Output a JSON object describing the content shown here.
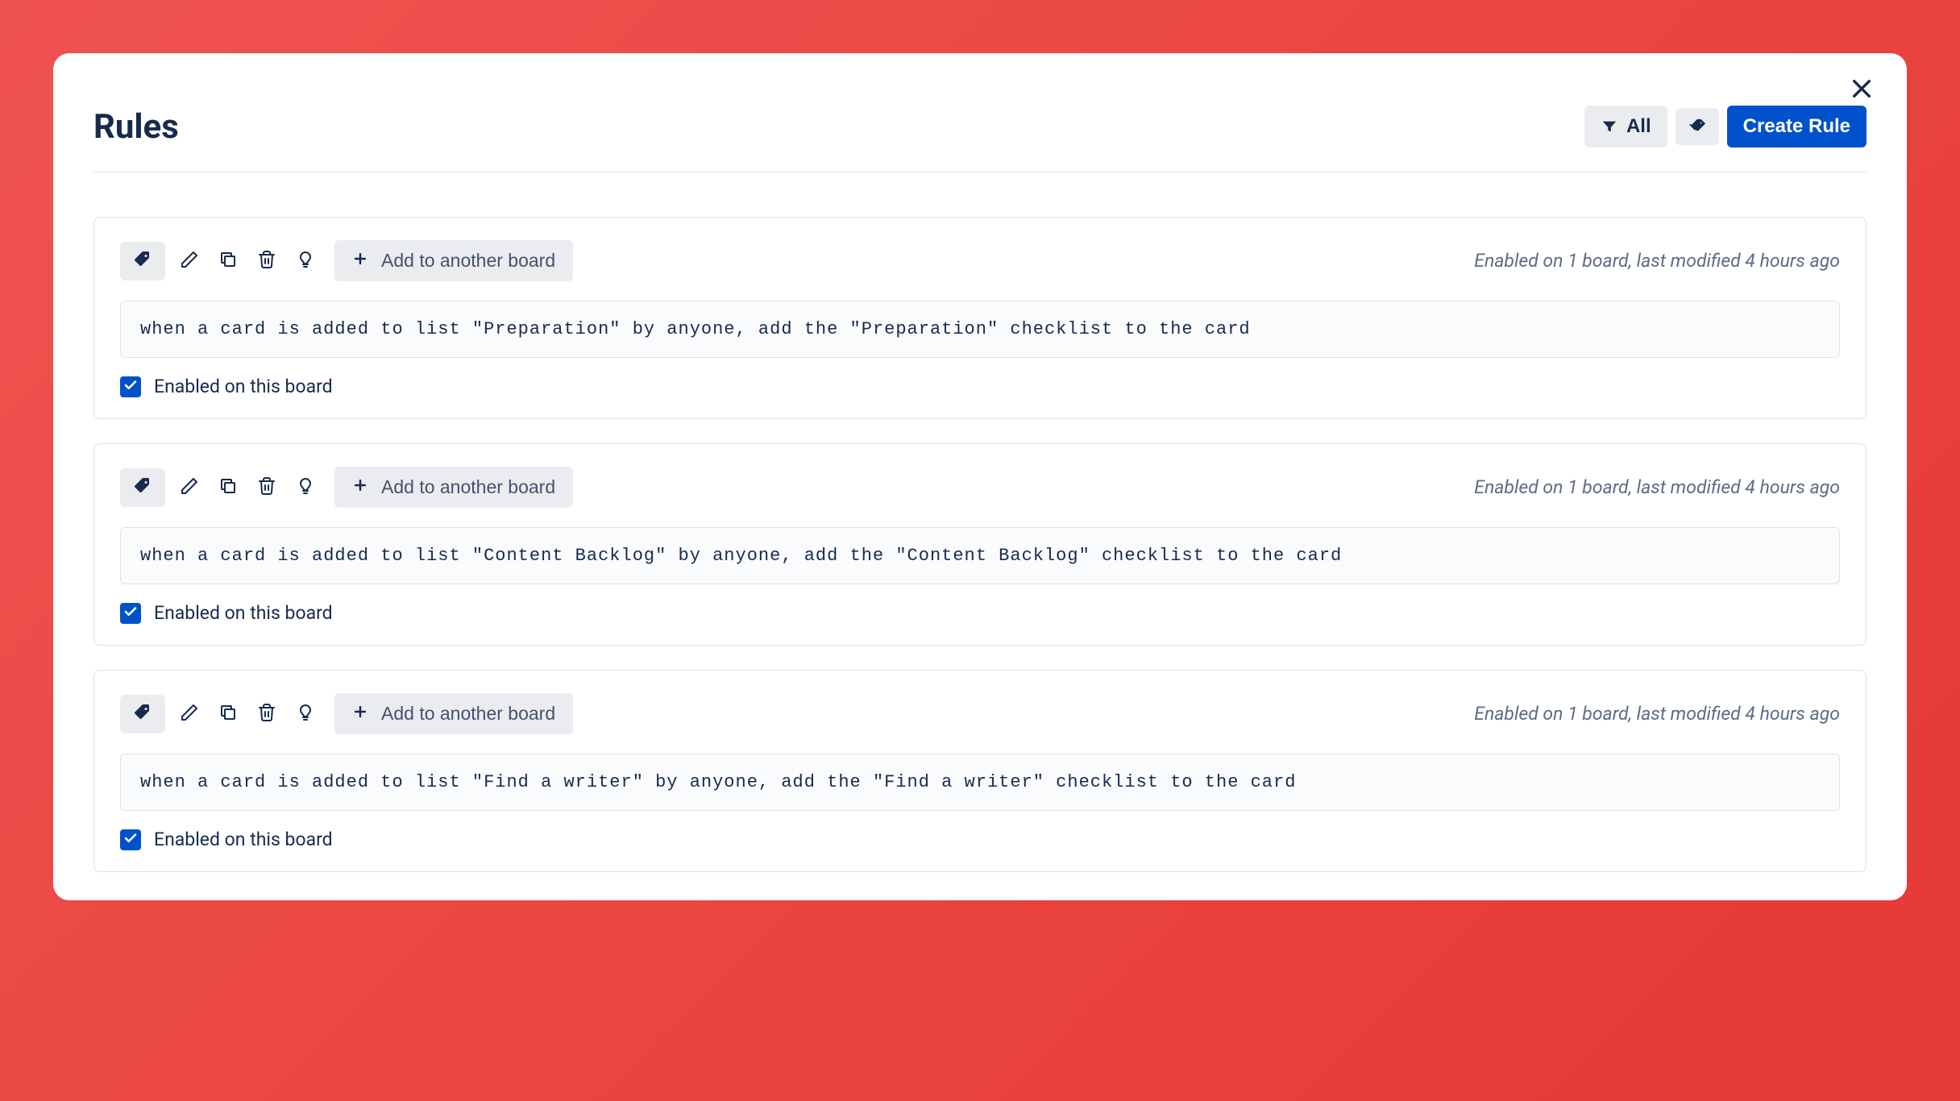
{
  "header": {
    "title": "Rules",
    "filter_label": "All",
    "create_label": "Create Rule"
  },
  "common": {
    "add_board_label": "Add to another board",
    "enabled_label": "Enabled on this board"
  },
  "rules": [
    {
      "meta": "Enabled on 1 board, last modified 4 hours ago",
      "body": "when a card is added to list \"Preparation\" by anyone, add the \"Preparation\" checklist to the card",
      "enabled": true
    },
    {
      "meta": "Enabled on 1 board, last modified 4 hours ago",
      "body": "when a card is added to list \"Content Backlog\" by anyone, add the \"Content Backlog\" checklist to the card",
      "enabled": true
    },
    {
      "meta": "Enabled on 1 board, last modified 4 hours ago",
      "body": "when a card is added to list \"Find a writer\" by anyone, add the \"Find a writer\" checklist to the card",
      "enabled": true
    }
  ]
}
